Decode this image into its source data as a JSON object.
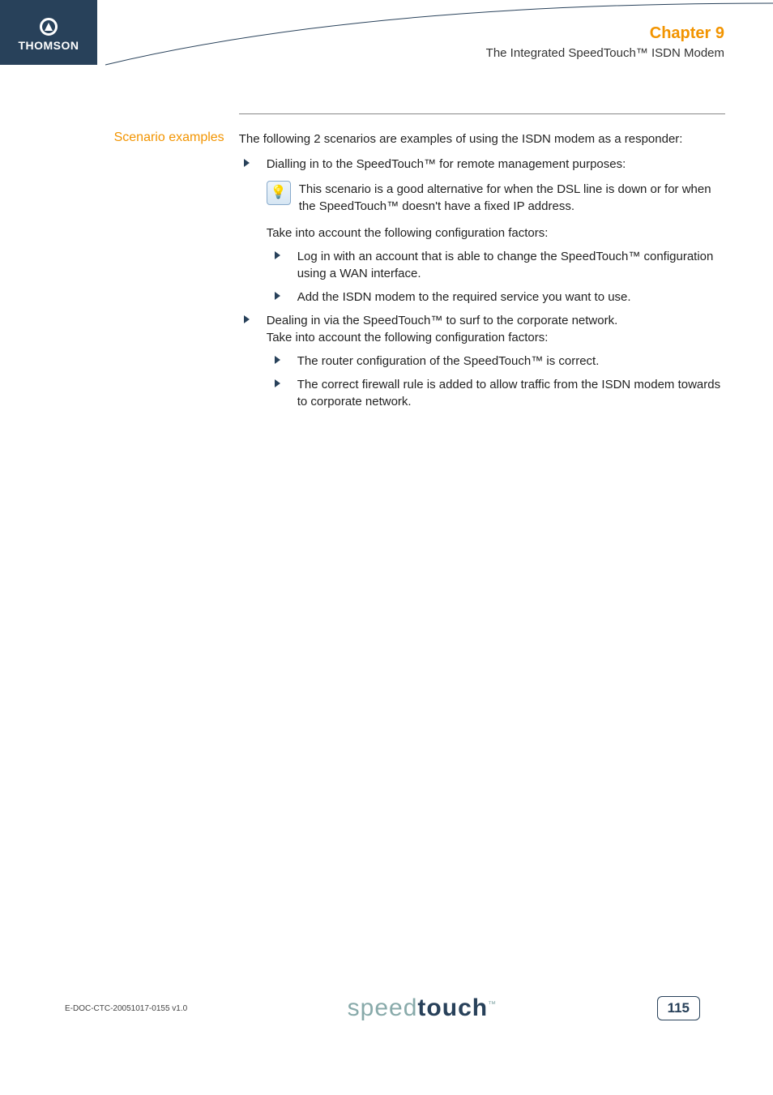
{
  "header": {
    "brand": "THOMSON",
    "chapter": "Chapter 9",
    "subtitle": "The Integrated SpeedTouch™ ISDN Modem"
  },
  "section": {
    "label": "Scenario examples",
    "intro": "The following 2 scenarios are examples of using the ISDN modem as a responder:",
    "item1": {
      "title": "Dialling in to the SpeedTouch™ for remote management purposes:",
      "tip": "This scenario is a good alternative for when the DSL line is down or for when the SpeedTouch™ doesn't have a fixed IP address.",
      "subintro": "Take into account the following configuration factors:",
      "sub1": "Log in with an account that is able to change the SpeedTouch™ configuration using a WAN interface.",
      "sub2": "Add the ISDN modem to the required service you want to use."
    },
    "item2": {
      "line1": "Dealing in via the SpeedTouch™ to surf to the corporate network.",
      "line2": "Take into account the following configuration factors:",
      "sub1": "The router configuration of the SpeedTouch™ is correct.",
      "sub2": "The correct firewall rule is added to allow traffic from the ISDN modem towards to corporate network."
    }
  },
  "footer": {
    "doc_id": "E-DOC-CTC-20051017-0155 v1.0",
    "logo_light": "speed",
    "logo_bold": "touch",
    "tm": "™",
    "page": "115"
  }
}
